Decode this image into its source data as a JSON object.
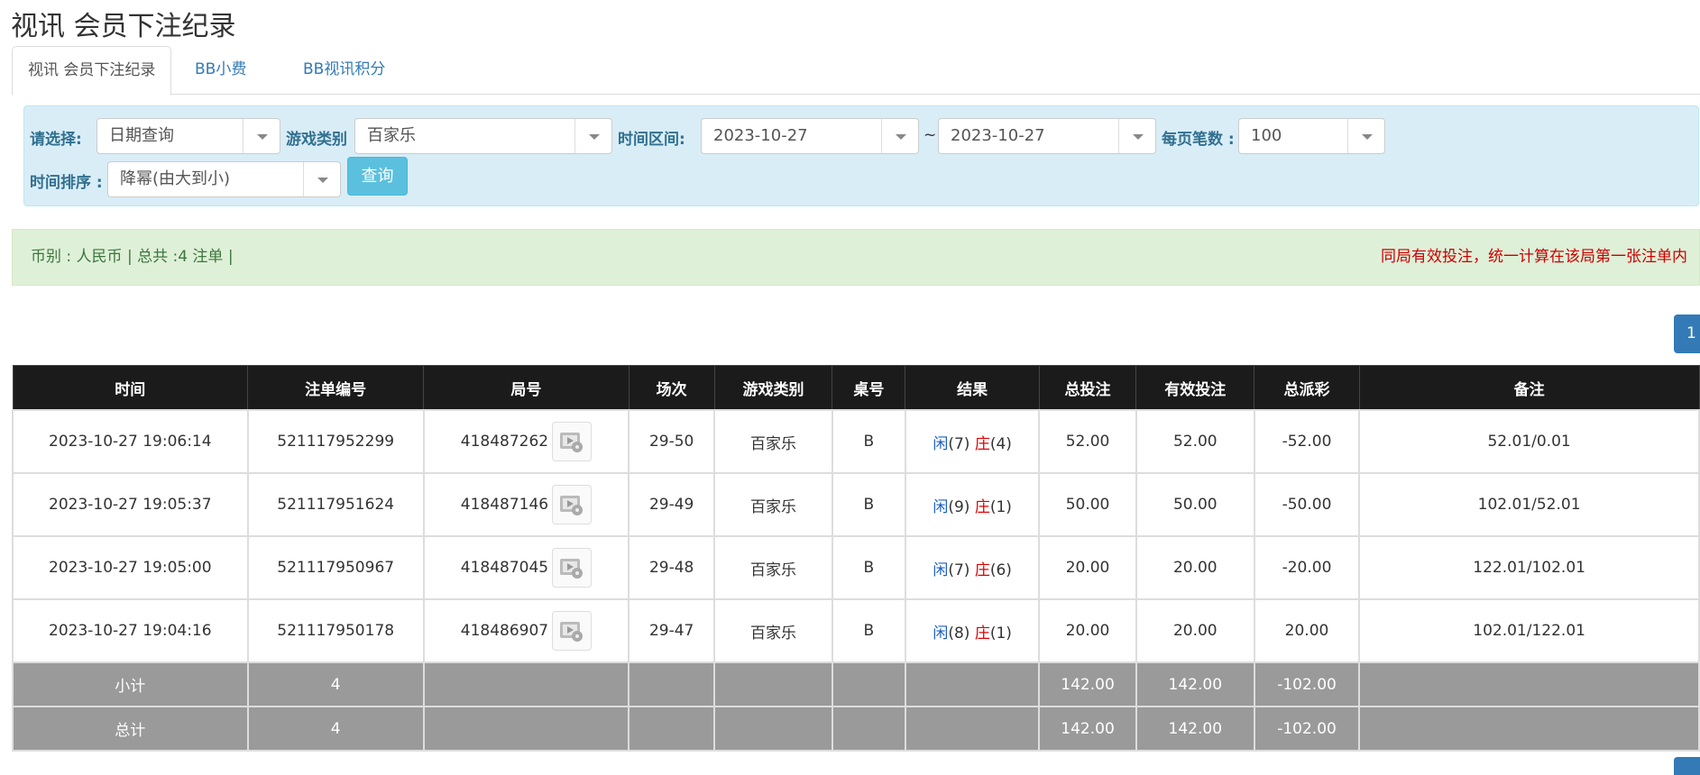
{
  "page": {
    "title": "视讯 会员下注纪录"
  },
  "tabs": [
    {
      "label": "视讯 会员下注纪录"
    },
    {
      "label": "BB小费"
    },
    {
      "label": "BB视讯积分"
    }
  ],
  "filters": {
    "select_label": "请选择:",
    "select_value": "日期查询",
    "game_type_label": "游戏类别",
    "game_type_value": "百家乐",
    "time_range_label": "时间区间:",
    "date_from": "2023-10-27",
    "date_sep": "~",
    "date_to": "2023-10-27",
    "per_page_label": "每页笔数 :",
    "per_page_value": "100",
    "sort_label": "时间排序 :",
    "sort_value": "降幂(由大到小)",
    "query_button": "查询"
  },
  "info": {
    "summary": "币别 : 人民币 | 总共 :4 注单 |",
    "notice": "同局有效投注，统一计算在该局第一张注单内"
  },
  "pagination": {
    "current": "1"
  },
  "table": {
    "headers": [
      "时间",
      "注单编号",
      "局号",
      "场次",
      "游戏类别",
      "桌号",
      "结果",
      "总投注",
      "有效投注",
      "总派彩",
      "备注"
    ],
    "rows": [
      {
        "time": "2023-10-27 19:06:14",
        "bet_id": "521117952299",
        "round": "418487262",
        "session": "29-50",
        "game": "百家乐",
        "table": "B",
        "player": "闲",
        "player_pts": "(7)",
        "banker": "庄",
        "banker_pts": "(4)",
        "total_bet": "52.00",
        "valid_bet": "52.00",
        "payout": "-52.00",
        "payout_neg": true,
        "remark": "52.01/0.01"
      },
      {
        "time": "2023-10-27 19:05:37",
        "bet_id": "521117951624",
        "round": "418487146",
        "session": "29-49",
        "game": "百家乐",
        "table": "B",
        "player": "闲",
        "player_pts": "(9)",
        "banker": "庄",
        "banker_pts": "(1)",
        "total_bet": "50.00",
        "valid_bet": "50.00",
        "payout": "-50.00",
        "payout_neg": true,
        "remark": "102.01/52.01"
      },
      {
        "time": "2023-10-27 19:05:00",
        "bet_id": "521117950967",
        "round": "418487045",
        "session": "29-48",
        "game": "百家乐",
        "table": "B",
        "player": "闲",
        "player_pts": "(7)",
        "banker": "庄",
        "banker_pts": "(6)",
        "total_bet": "20.00",
        "valid_bet": "20.00",
        "payout": "-20.00",
        "payout_neg": true,
        "remark": "122.01/102.01"
      },
      {
        "time": "2023-10-27 19:04:16",
        "bet_id": "521117950178",
        "round": "418486907",
        "session": "29-47",
        "game": "百家乐",
        "table": "B",
        "player": "闲",
        "player_pts": "(8)",
        "banker": "庄",
        "banker_pts": "(1)",
        "total_bet": "20.00",
        "valid_bet": "20.00",
        "payout": "20.00",
        "payout_neg": false,
        "remark": "102.01/122.01"
      }
    ],
    "subtotal": {
      "label": "小计",
      "count": "4",
      "total_bet": "142.00",
      "valid_bet": "142.00",
      "payout": "-102.00"
    },
    "total": {
      "label": "总计",
      "count": "4",
      "total_bet": "142.00",
      "valid_bet": "142.00",
      "payout": "-102.00"
    }
  },
  "colors": {
    "blue": "#1a5fc4",
    "red": "#e00000",
    "header_bg": "#1b1b1b",
    "sum_bg": "#9a9a9a",
    "filter_bg": "#d9edf7",
    "info_bg": "#dff0d8"
  }
}
